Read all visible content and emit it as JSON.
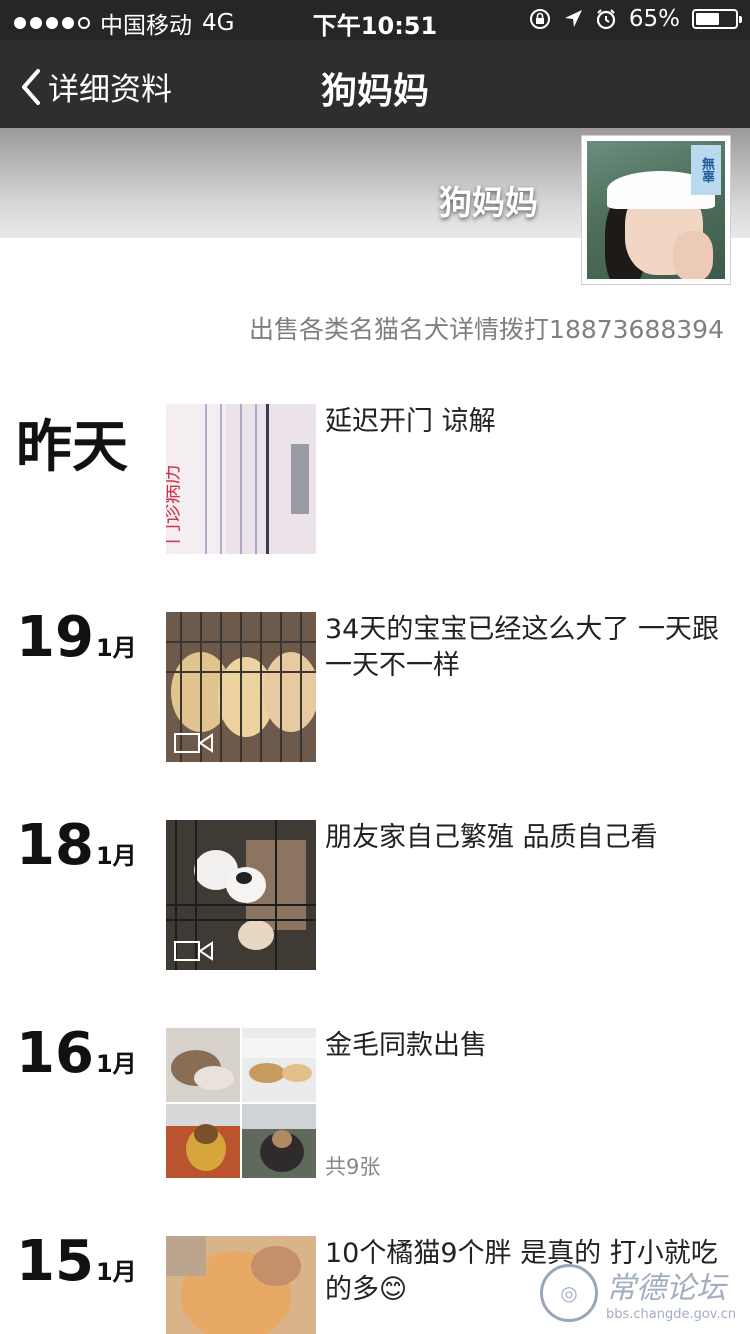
{
  "statusbar": {
    "carrier": "中国移动",
    "network": "4G",
    "time": "下午10:51",
    "battery": "65%",
    "battery_level": 0.65
  },
  "navbar": {
    "back_label": "详细资料",
    "title": "狗妈妈"
  },
  "profile": {
    "cover_name": "狗妈妈",
    "avatar_tag": "無辜",
    "signature": "出售各类名猫名犬详情拨打18873688394"
  },
  "posts": [
    {
      "day": "昨天",
      "month": "",
      "caption": "延迟开门 谅解"
    },
    {
      "day": "19",
      "month": "1月",
      "caption": "34天的宝宝已经这么大了 一天跟一天不一样"
    },
    {
      "day": "18",
      "month": "1月",
      "caption": "朋友家自己繁殖 品质自己看"
    },
    {
      "day": "16",
      "month": "1月",
      "caption": "金毛同款出售",
      "count": "共9张"
    },
    {
      "day": "15",
      "month": "1月",
      "caption": "10个橘猫9个胖 是真的 打小就吃的多😊"
    }
  ],
  "watermark": {
    "text": "常德论坛",
    "url": "bbs.changde.gov.cn"
  }
}
